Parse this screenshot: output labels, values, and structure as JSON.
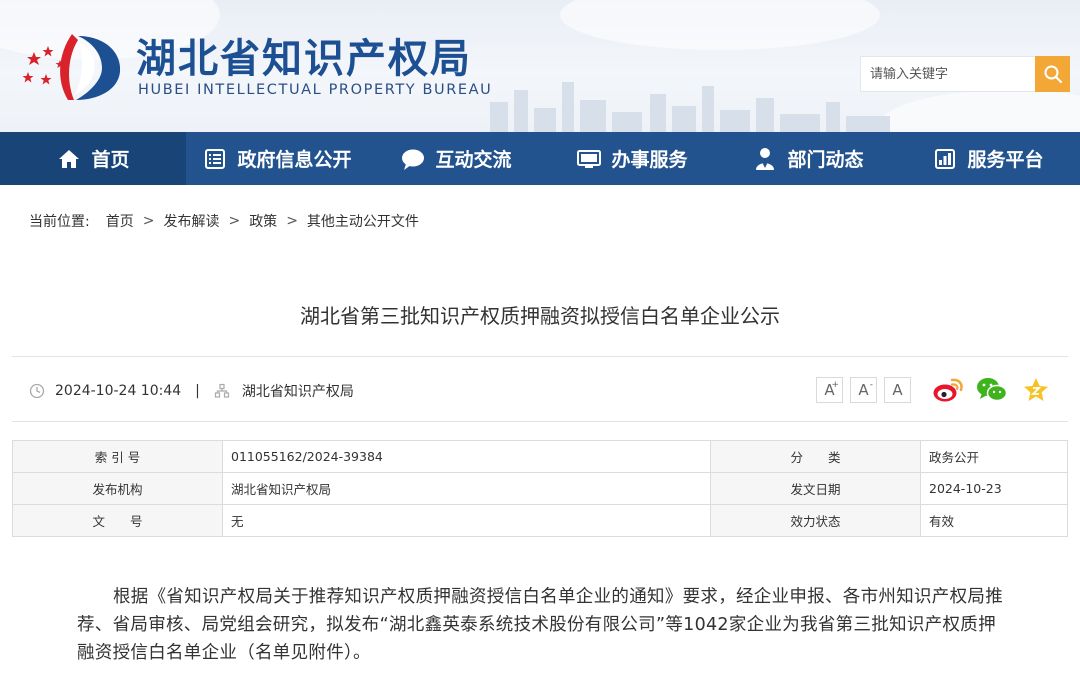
{
  "header": {
    "site_title": "湖北省知识产权局",
    "site_subtitle": "HUBEI INTELLECTUAL PROPERTY BUREAU",
    "search_placeholder": "请输入关键字"
  },
  "colors": {
    "brand_blue": "#23538f",
    "nav_active": "#184478",
    "search_orange": "#f3a736",
    "logo_red": "#d8232a"
  },
  "nav": {
    "items": [
      {
        "label": "首页",
        "icon": "home-icon"
      },
      {
        "label": "政府信息公开",
        "icon": "document-list-icon"
      },
      {
        "label": "互动交流",
        "icon": "chat-bubble-icon"
      },
      {
        "label": "办事服务",
        "icon": "monitor-icon"
      },
      {
        "label": "部门动态",
        "icon": "person-icon"
      },
      {
        "label": "服务平台",
        "icon": "bar-chart-icon"
      }
    ]
  },
  "breadcrumb": {
    "label": "当前位置:",
    "items": [
      "首页",
      "发布解读",
      "政策",
      "其他主动公开文件"
    ],
    "separator": ">"
  },
  "article": {
    "title": "湖北省第三批知识产权质押融资拟授信白名单企业公示",
    "date": "2024-10-24 10:44",
    "divider": "|",
    "source": "湖北省知识产权局",
    "font_sizes": {
      "large": "A",
      "medium": "A",
      "small": "A",
      "plus": "+",
      "minus": "-"
    },
    "share_icons": [
      "weibo-icon",
      "wechat-icon",
      "favorite-star-icon"
    ],
    "body": "根据《省知识产权局关于推荐知识产权质押融资授信白名单企业的通知》要求，经企业申报、各市州知识产权局推荐、省局审核、局党组会研究，拟发布“湖北鑫英泰系统技术股份有限公司”等1042家企业为我省第三批知识产权质押融资授信白名单企业（名单见附件）。"
  },
  "info_table": {
    "rows": [
      {
        "k1": "索 引 号",
        "v1": "011055162/2024-39384",
        "k2": "分　　类",
        "v2": "政务公开"
      },
      {
        "k1": "发布机构",
        "v1": "湖北省知识产权局",
        "k2": "发文日期",
        "v2": "2024-10-23"
      },
      {
        "k1": "文　　号",
        "v1": "无",
        "k2": "效力状态",
        "v2": "有效"
      }
    ]
  }
}
